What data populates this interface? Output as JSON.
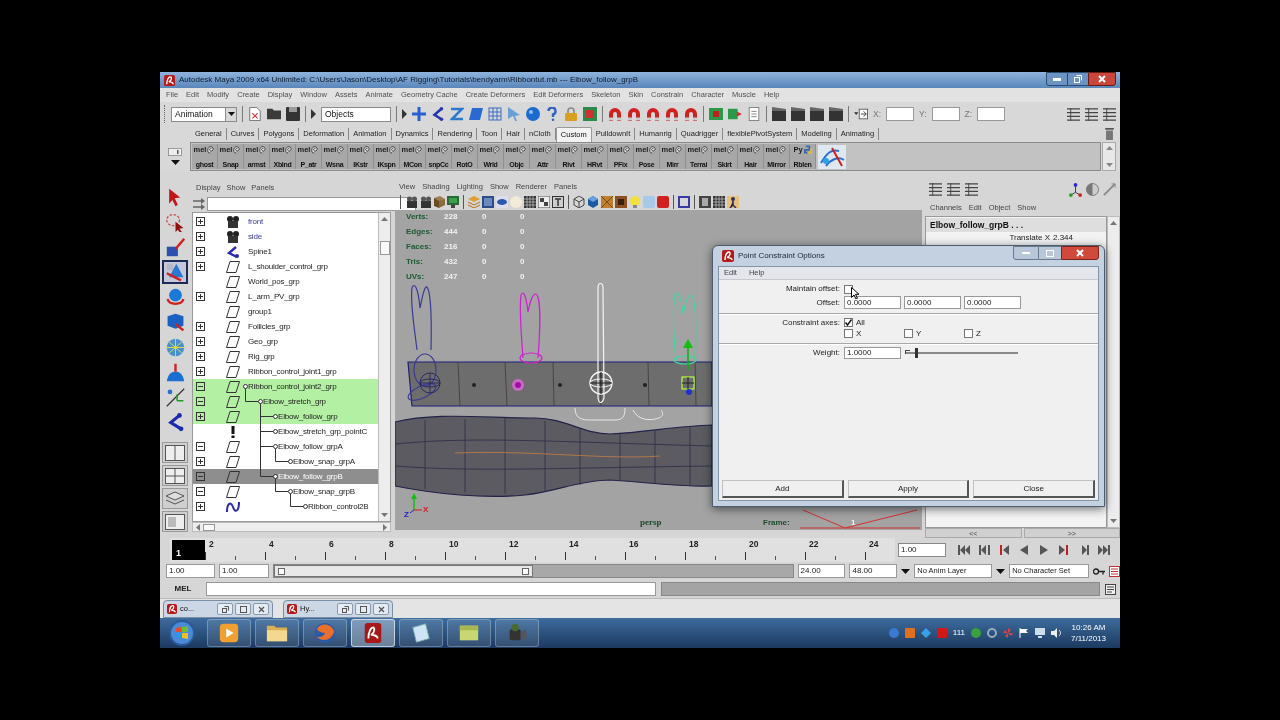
{
  "window": {
    "title": "Autodesk Maya 2009 x64 Unlimited: C:\\Users\\Jason\\Desktop\\AF Rigging\\Tutorials\\bendyarm\\Ribbontut.mb --- Elbow_follow_grpB"
  },
  "menu": [
    "File",
    "Edit",
    "Modify",
    "Create",
    "Display",
    "Window",
    "Assets",
    "Animate",
    "Geometry Cache",
    "Create Deformers",
    "Edit Deformers",
    "Skeleton",
    "Skin",
    "Constrain",
    "Character",
    "Muscle",
    "Help"
  ],
  "status_line": {
    "menu_set": "Animation",
    "selection_mode": "Objects",
    "coordinates": [
      {
        "label": "X:"
      },
      {
        "label": "Y:"
      },
      {
        "label": "Z:"
      }
    ]
  },
  "shelf_tabs": [
    {
      "label": "General",
      "selected": false
    },
    {
      "label": "Curves",
      "selected": false
    },
    {
      "label": "Polygons",
      "selected": false
    },
    {
      "label": "Deformation",
      "selected": false
    },
    {
      "label": "Animation",
      "selected": false
    },
    {
      "label": "Dynamics",
      "selected": false
    },
    {
      "label": "Rendering",
      "selected": false
    },
    {
      "label": "Toon",
      "selected": false
    },
    {
      "label": "Hair",
      "selected": false
    },
    {
      "label": "nCloth",
      "selected": false
    },
    {
      "label": "Custom",
      "selected": true
    },
    {
      "label": "PulldownIt",
      "selected": false
    },
    {
      "label": "Humanrig",
      "selected": false
    },
    {
      "label": "Quadrigger",
      "selected": false
    },
    {
      "label": "flexiblePivotSystem",
      "selected": false
    },
    {
      "label": "Modeling",
      "selected": false
    },
    {
      "label": "Animating",
      "selected": false
    }
  ],
  "shelf_buttons": [
    {
      "kind": "mel",
      "badge": "mel",
      "label": "ghost"
    },
    {
      "kind": "mel",
      "badge": "mel",
      "label": "Snap"
    },
    {
      "kind": "mel",
      "badge": "mel",
      "label": "armst"
    },
    {
      "kind": "mel",
      "badge": "mel",
      "label": "Xblnd"
    },
    {
      "kind": "mel",
      "badge": "mel",
      "label": "P_atr"
    },
    {
      "kind": "mel",
      "badge": "mel",
      "label": "Wsna"
    },
    {
      "kind": "mel",
      "badge": "mel",
      "label": "IKstr"
    },
    {
      "kind": "mel",
      "badge": "mel",
      "label": "IKspn"
    },
    {
      "kind": "mel",
      "badge": "mel",
      "label": "MCon"
    },
    {
      "kind": "mel",
      "badge": "mel",
      "label": "snpCc"
    },
    {
      "kind": "mel",
      "badge": "mel",
      "label": "RotO"
    },
    {
      "kind": "mel",
      "badge": "mel",
      "label": "Wrld"
    },
    {
      "kind": "mel",
      "badge": "mel",
      "label": "Objc"
    },
    {
      "kind": "mel",
      "badge": "mel",
      "label": "Attr"
    },
    {
      "kind": "mel",
      "badge": "mel",
      "label": "Rivt"
    },
    {
      "kind": "mel",
      "badge": "mel",
      "label": "HRvt"
    },
    {
      "kind": "mel",
      "badge": "mel",
      "label": "PFix"
    },
    {
      "kind": "mel",
      "badge": "mel",
      "label": "Pose"
    },
    {
      "kind": "mel",
      "badge": "mel",
      "label": "Mirr"
    },
    {
      "kind": "mel",
      "badge": "mel",
      "label": "Terrai"
    },
    {
      "kind": "mel",
      "badge": "mel",
      "label": "Skirt"
    },
    {
      "kind": "mel",
      "badge": "mel",
      "label": "Hair"
    },
    {
      "kind": "mel",
      "badge": "mel",
      "label": "Mirror"
    },
    {
      "kind": "python",
      "badge": "Py",
      "label": "Rblen"
    },
    {
      "kind": "image"
    }
  ],
  "toolbox": [
    {
      "kind": "select",
      "selected": false
    },
    {
      "kind": "lasso",
      "selected": false
    },
    {
      "kind": "paint",
      "selected": false
    },
    {
      "kind": "move",
      "selected": true
    },
    {
      "kind": "rotate",
      "selected": false
    },
    {
      "kind": "scale",
      "selected": false
    },
    {
      "kind": "universal",
      "selected": false
    },
    {
      "kind": "soft",
      "selected": false
    },
    {
      "kind": "manip",
      "selected": false
    },
    {
      "kind": "joint",
      "selected": false
    }
  ],
  "outliner": {
    "menu": [
      "Display",
      "Show",
      "Panels"
    ],
    "tree": [
      {
        "label": "front",
        "kind": "camera",
        "expanded": false,
        "selected": false,
        "highlighted": false
      },
      {
        "label": "side",
        "kind": "camera",
        "expanded": false,
        "selected": false,
        "highlighted": false
      },
      {
        "label": "Spine1",
        "kind": "joint",
        "expanded": false,
        "selected": false,
        "highlighted": false
      },
      {
        "label": "L_shoulder_control_grp",
        "kind": "transform",
        "expanded": false,
        "selected": false,
        "highlighted": false
      },
      {
        "label": "World_pos_grp",
        "kind": "transform",
        "selected": false,
        "highlighted": false
      },
      {
        "label": "L_arm_PV_grp",
        "kind": "transform",
        "expanded": false,
        "selected": false,
        "highlighted": false
      },
      {
        "label": "group1",
        "kind": "transform",
        "selected": false,
        "highlighted": false
      },
      {
        "label": "Follicles_grp",
        "kind": "transform",
        "expanded": false,
        "selected": false,
        "highlighted": false
      },
      {
        "label": "Geo_grp",
        "kind": "transform",
        "expanded": false,
        "selected": false,
        "highlighted": false
      },
      {
        "label": "Rig_grp",
        "kind": "transform",
        "expanded": false,
        "selected": false,
        "highlighted": false
      },
      {
        "label": "Ribbon_control_joint1_grp",
        "kind": "transform",
        "expanded": false,
        "selected": false,
        "highlighted": false
      },
      {
        "label": "Ribbon_control_joint2_grp",
        "kind": "transform",
        "expanded": true,
        "selected": false,
        "highlighted": true,
        "children": [
          {
            "label": "Elbow_stretch_grp",
            "kind": "transform",
            "expanded": true,
            "selected": false,
            "highlighted": true,
            "children": [
              {
                "label": "Elbow_follow_grp",
                "kind": "transform",
                "expanded": false,
                "selected": false,
                "highlighted": true
              },
              {
                "label": "Elbow_stretch_grp_pointC",
                "kind": "constraint",
                "selected": false,
                "highlighted": false
              },
              {
                "label": "Elbow_follow_grpA",
                "kind": "transform",
                "expanded": true,
                "selected": false,
                "highlighted": false,
                "children": [
                  {
                    "label": "Elbow_snap_grpA",
                    "kind": "transform",
                    "expanded": false,
                    "selected": false,
                    "highlighted": false
                  }
                ]
              },
              {
                "label": "Elbow_follow_grpB",
                "kind": "transform",
                "expanded": true,
                "selected": true,
                "highlighted": false,
                "children": [
                  {
                    "label": "Elbow_snap_grpB",
                    "kind": "transform",
                    "expanded": true,
                    "selected": false,
                    "highlighted": false,
                    "children": [
                      {
                        "label": "Ribbon_control2B",
                        "kind": "curve",
                        "expanded": false,
                        "selected": false,
                        "highlighted": false
                      }
                    ]
                  }
                ]
              }
            ]
          }
        ]
      }
    ]
  },
  "viewport": {
    "menu": [
      "View",
      "Shading",
      "Lighting",
      "Show",
      "Renderer",
      "Panels"
    ],
    "hud": [
      {
        "label": "Verts:",
        "values": [
          "228",
          "0",
          "0"
        ]
      },
      {
        "label": "Edges:",
        "values": [
          "444",
          "0",
          "0"
        ]
      },
      {
        "label": "Faces:",
        "values": [
          "216",
          "0",
          "0"
        ]
      },
      {
        "label": "Tris:",
        "values": [
          "432",
          "0",
          "0"
        ]
      },
      {
        "label": "UVs:",
        "values": [
          "247",
          "0",
          "0"
        ]
      }
    ],
    "axis_labels": [
      "Z",
      "X"
    ],
    "camera": "persp",
    "frame_label": "Frame:",
    "frame_value": "1"
  },
  "channel_box": {
    "menu": [
      "Channels",
      "Edit",
      "Object",
      "Show"
    ],
    "object": "Elbow_follow_grpB . . .",
    "channels": [
      {
        "name": "Translate X",
        "value": "2.344"
      }
    ],
    "pager": [
      "<<",
      ">>"
    ]
  },
  "dialog": {
    "title": "Point Constraint Options",
    "menu": [
      "Edit",
      "Help"
    ],
    "maintain_offset": {
      "label": "Maintain offset:",
      "checked": false
    },
    "offset": {
      "label": "Offset:",
      "values": [
        "0.0000",
        "0.0000",
        "0.0000"
      ]
    },
    "constraint_axes": {
      "label": "Constraint axes:",
      "options": [
        {
          "label": "All",
          "checked": true
        },
        {
          "label": "X",
          "checked": false
        },
        {
          "label": "Y",
          "checked": false
        },
        {
          "label": "Z",
          "checked": false
        }
      ]
    },
    "weight": {
      "label": "Weight:",
      "value": "1.0000",
      "level": 0.1
    },
    "buttons": [
      "Add",
      "Apply",
      "Close"
    ]
  },
  "time_slider": {
    "current_frame": "1",
    "level": 0,
    "labels": [
      "2",
      "4",
      "6",
      "8",
      "10",
      "12",
      "14",
      "16",
      "18",
      "20",
      "22",
      "24"
    ],
    "current_time": "1.00"
  },
  "range_slider": {
    "start": "1.00",
    "playback_start": "1.00",
    "playback_end": "24.00",
    "end": "48.00",
    "level": 0.5,
    "anim_layer": "No Anim Layer",
    "character_set": "No Character Set"
  },
  "command_line": {
    "language": "MEL"
  },
  "minimized_windows": [
    {
      "title": "co..."
    },
    {
      "title": "Hy..."
    }
  ],
  "taskbar": {
    "apps": [
      {
        "kind": "media",
        "selected": false
      },
      {
        "kind": "folder",
        "selected": false
      },
      {
        "kind": "browser",
        "selected": false
      },
      {
        "kind": "maya",
        "selected": true
      },
      {
        "kind": "paper",
        "selected": false
      },
      {
        "kind": "note",
        "selected": false
      },
      {
        "kind": "camera",
        "selected": false
      }
    ],
    "tray_count": "111",
    "time": "10:26 AM",
    "date": "7/11/2013"
  }
}
